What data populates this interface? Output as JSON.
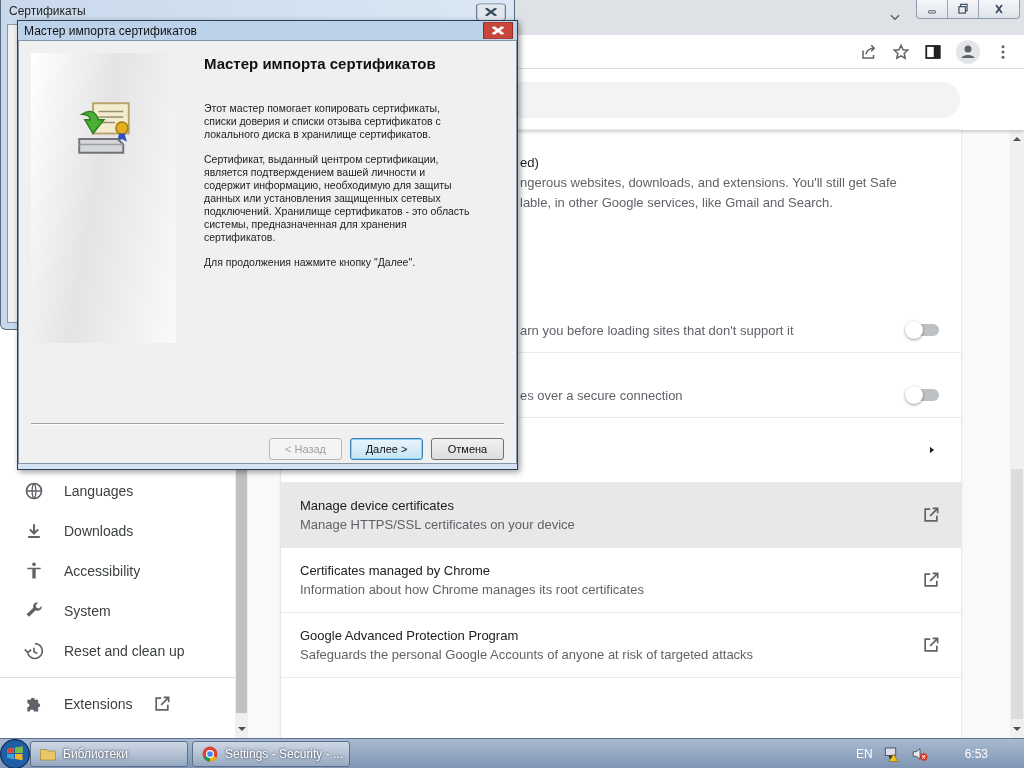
{
  "certificates_window": {
    "title": "Сертификаты"
  },
  "browser": {
    "sidebar": {
      "items": [
        {
          "label": "Languages"
        },
        {
          "label": "Downloads"
        },
        {
          "label": "Accessibility"
        },
        {
          "label": "System"
        },
        {
          "label": "Reset and clean up"
        }
      ],
      "extensions": {
        "label": "Extensions"
      }
    },
    "settings": [
      {
        "kind": "text",
        "lines": [
          "ed)",
          "ngerous websites, downloads, and extensions. You'll still get Safe",
          "lable, in other Google services, like Gmail and Search."
        ]
      },
      {
        "kind": "toggle",
        "text": "arn you before loading sites that don't support it",
        "on": false
      },
      {
        "kind": "toggle",
        "text": "es over a secure connection",
        "on": false
      },
      {
        "kind": "arrow"
      },
      {
        "kind": "link",
        "title": "Manage device certificates",
        "subtitle": "Manage HTTPS/SSL certificates on your device",
        "hovered": true
      },
      {
        "kind": "link",
        "title": "Certificates managed by Chrome",
        "subtitle": "Information about how Chrome manages its root certificates",
        "hovered": false
      },
      {
        "kind": "link",
        "title": "Google Advanced Protection Program",
        "subtitle": "Safeguards the personal Google Accounts of anyone at risk of targeted attacks",
        "hovered": false
      }
    ]
  },
  "wizard": {
    "title": "Мастер импорта сертификатов",
    "heading": "Мастер импорта сертификатов",
    "paragraphs": [
      "Этот мастер помогает копировать сертификаты, списки доверия и списки отзыва сертификатов с локального диска в хранилище сертификатов.",
      "Сертификат, выданный центром сертификации, является подтверждением вашей личности и содержит информацию, необходимую для защиты данных или установления защищенных сетевых подключений. Хранилище сертификатов - это область системы, предназначенная для хранения сертификатов.",
      "Для продолжения нажмите кнопку \"Далее\"."
    ],
    "buttons": [
      {
        "label": "< Назад",
        "disabled": true,
        "focused": false
      },
      {
        "label": "Далее >",
        "disabled": false,
        "focused": true
      },
      {
        "label": "Отмена",
        "disabled": false,
        "focused": false
      }
    ]
  },
  "taskbar": {
    "buttons": [
      {
        "label": "Библиотеки"
      },
      {
        "label": "Settings - Security - ..."
      }
    ],
    "language": "EN",
    "clock": "6:53"
  }
}
